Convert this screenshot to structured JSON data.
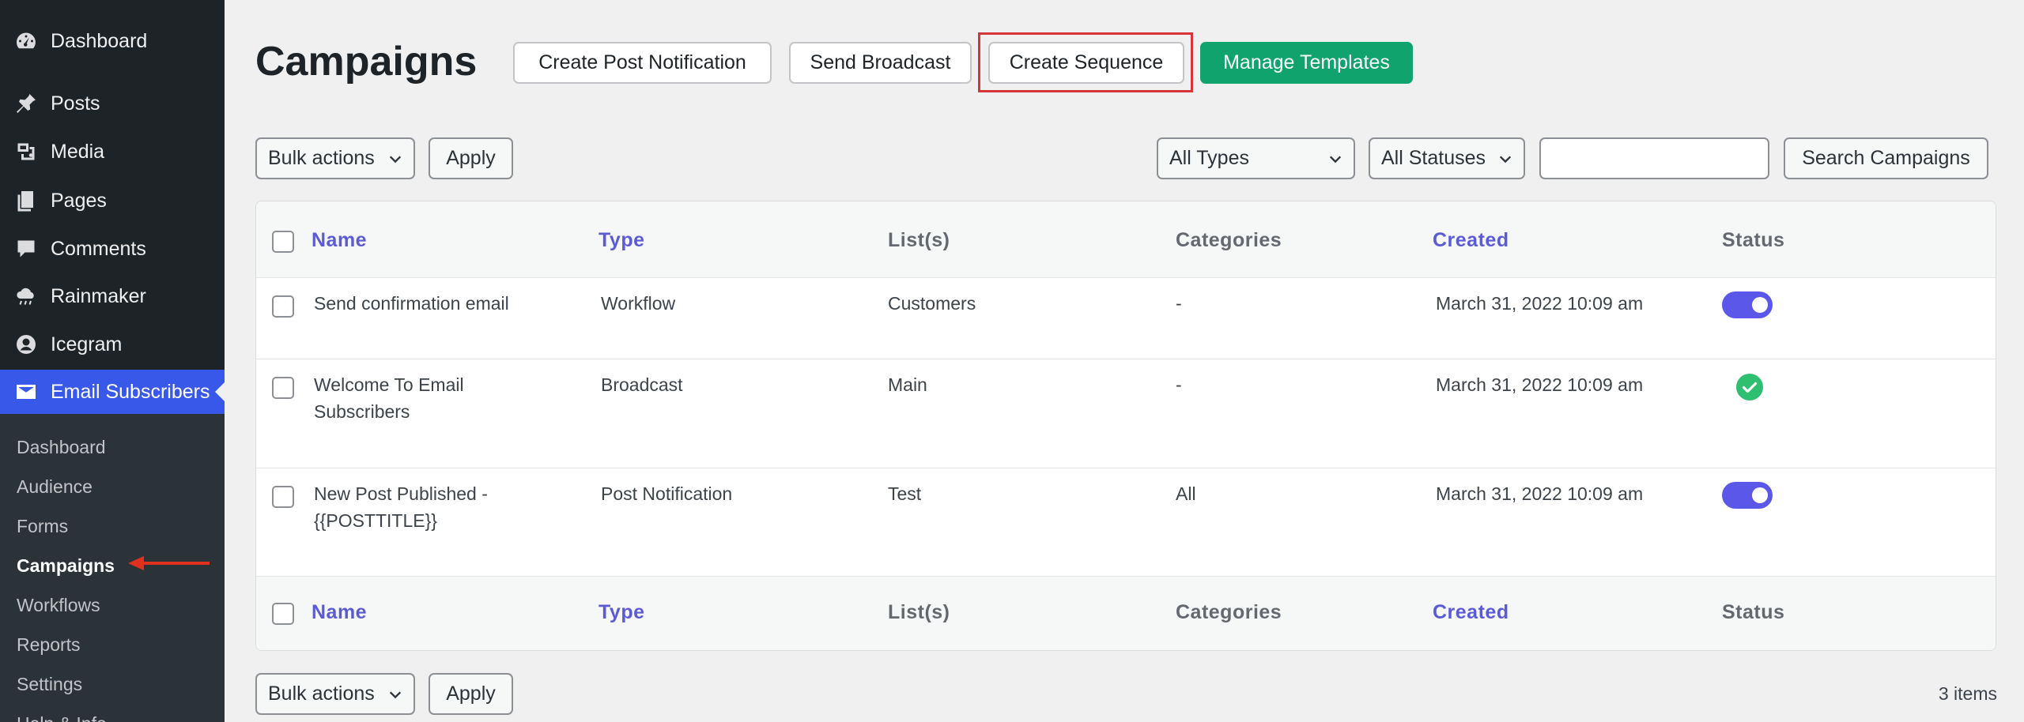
{
  "sidebar": {
    "items": [
      {
        "label": "Dashboard",
        "icon": "dashboard-icon"
      },
      {
        "label": "Posts",
        "icon": "pin-icon"
      },
      {
        "label": "Media",
        "icon": "media-icon"
      },
      {
        "label": "Pages",
        "icon": "pages-icon"
      },
      {
        "label": "Comments",
        "icon": "comment-icon"
      },
      {
        "label": "Rainmaker",
        "icon": "cloud-icon"
      },
      {
        "label": "Icegram",
        "icon": "icegram-icon"
      },
      {
        "label": "Email Subscribers",
        "icon": "envelope-icon"
      }
    ],
    "submenu": [
      "Dashboard",
      "Audience",
      "Forms",
      "Campaigns",
      "Workflows",
      "Reports",
      "Settings",
      "Help & Info"
    ]
  },
  "header": {
    "title": "Campaigns",
    "buttons": [
      "Create Post Notification",
      "Send Broadcast",
      "Create Sequence",
      "Manage Templates"
    ]
  },
  "toolbar": {
    "bulk_actions": "Bulk actions",
    "apply": "Apply",
    "types": "All Types",
    "statuses": "All Statuses",
    "search_value": "",
    "search_button": "Search Campaigns"
  },
  "table": {
    "columns": [
      "Name",
      "Type",
      "List(s)",
      "Categories",
      "Created",
      "Status"
    ],
    "rows": [
      {
        "name": "Send confirmation email",
        "type": "Workflow",
        "lists": "Customers",
        "categories": "-",
        "created": "March 31, 2022 10:09 am",
        "status": "toggle-on"
      },
      {
        "name_line1": "Welcome To Email",
        "name_line2": "Subscribers",
        "type": "Broadcast",
        "lists": "Main",
        "categories": "-",
        "created": "March 31, 2022 10:09 am",
        "status": "sent-check"
      },
      {
        "name_line1": "New Post Published -",
        "name_line2": "{{POSTTITLE}}",
        "type": "Post Notification",
        "lists": "Test",
        "categories": "All",
        "created": "March 31, 2022 10:09 am",
        "status": "toggle-on"
      }
    ]
  },
  "footer": {
    "bulk_actions": "Bulk actions",
    "apply": "Apply",
    "items_count": "3 items"
  },
  "colors": {
    "sidebar_bg": "#1d2327",
    "active_menu": "#3858e9",
    "link_header": "#5b5bd6",
    "green_button": "#10a36e",
    "highlight": "#d63638",
    "toggle": "#5b57e8"
  }
}
